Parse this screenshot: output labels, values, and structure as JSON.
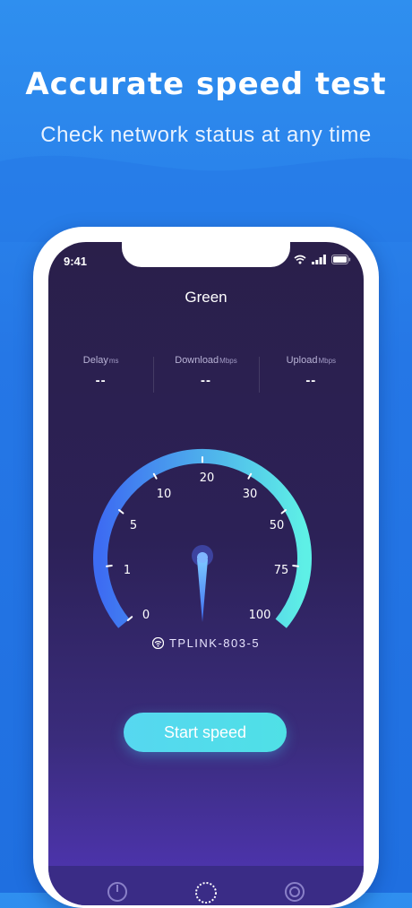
{
  "hero": {
    "title": "Accurate speed test",
    "subtitle": "Check network status at any time"
  },
  "status_bar": {
    "time": "9:41"
  },
  "app": {
    "title": "Green"
  },
  "metrics": [
    {
      "label": "Delay",
      "unit": "ms",
      "value": "--"
    },
    {
      "label": "Download",
      "unit": "Mbps",
      "value": "--"
    },
    {
      "label": "Upload",
      "unit": "Mbps",
      "value": "--"
    }
  ],
  "gauge": {
    "tick_labels": [
      "0",
      "1",
      "5",
      "10",
      "20",
      "30",
      "50",
      "75",
      "100"
    ]
  },
  "network": {
    "ssid": "TPLINK-803-5"
  },
  "actions": {
    "start_label": "Start speed"
  },
  "colors": {
    "gauge_start": "#3d6cf2",
    "gauge_end": "#5ef0e6",
    "button": "#56d7f0"
  }
}
